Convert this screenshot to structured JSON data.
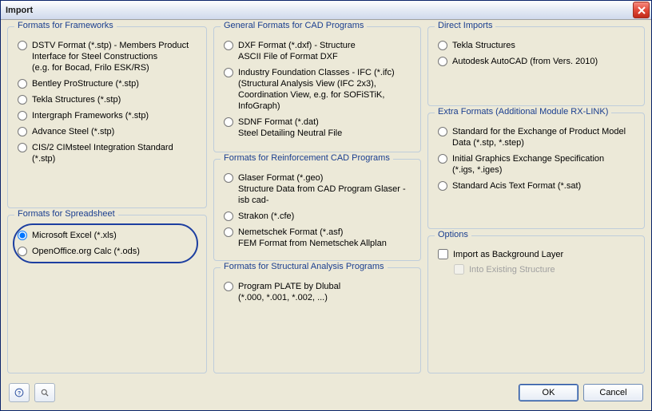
{
  "window": {
    "title": "Import"
  },
  "groups": {
    "frameworks": {
      "legend": "Formats for Frameworks",
      "items": [
        {
          "main": "DSTV Format (*.stp) - Members Product",
          "sub1": "Interface for Steel Constructions",
          "sub2": "(e.g. for Bocad, Frilo ESK/RS)"
        },
        {
          "main": "Bentley ProStructure (*.stp)"
        },
        {
          "main": "Tekla Structures (*.stp)"
        },
        {
          "main": "Intergraph Frameworks (*.stp)"
        },
        {
          "main": "Advance Steel (*.stp)"
        },
        {
          "main": "CIS/2 CIMsteel Integration Standard (*.stp)"
        }
      ]
    },
    "spreadsheet": {
      "legend": "Formats for Spreadsheet",
      "items": [
        {
          "main": "Microsoft Excel (*.xls)",
          "selected": true
        },
        {
          "main": "OpenOffice.org Calc (*.ods)"
        }
      ]
    },
    "general_cad": {
      "legend": "General Formats for CAD Programs",
      "items": [
        {
          "main": "DXF Format (*.dxf) - Structure",
          "sub1": "ASCII File of Format DXF"
        },
        {
          "main": "Industry Foundation Classes - IFC (*.ifc)",
          "sub1": "(Structural Analysis View (IFC 2x3),",
          "sub2": "Coordination View, e.g. for SOFiSTiK, InfoGraph)"
        },
        {
          "main": "SDNF Format (*.dat)",
          "sub1": "Steel Detailing Neutral File"
        }
      ]
    },
    "reinf_cad": {
      "legend": "Formats for Reinforcement CAD Programs",
      "items": [
        {
          "main": "Glaser Format (*.geo)",
          "sub1": "Structure Data from CAD Program Glaser -isb cad-"
        },
        {
          "main": "Strakon (*.cfe)"
        },
        {
          "main": "Nemetschek Format (*.asf)",
          "sub1": "FEM Format from Nemetschek Allplan"
        }
      ]
    },
    "structural": {
      "legend": "Formats for Structural Analysis Programs",
      "items": [
        {
          "main": "Program PLATE by Dlubal",
          "sub1": "(*.000, *.001, *.002, ...)"
        }
      ]
    },
    "direct_imports": {
      "legend": "Direct Imports",
      "items": [
        {
          "main": "Tekla Structures"
        },
        {
          "main": "Autodesk AutoCAD (from Vers. 2010)"
        }
      ]
    },
    "extra": {
      "legend": "Extra Formats (Additional Module RX-LINK)",
      "items": [
        {
          "main": "Standard for the Exchange of Product Model",
          "sub1": "Data (*.stp, *.step)"
        },
        {
          "main": "Initial Graphics Exchange Specification",
          "sub1": "(*.igs, *.iges)"
        },
        {
          "main": "Standard Acis Text Format (*.sat)"
        }
      ]
    },
    "options": {
      "legend": "Options",
      "bg_layer": "Import as Background Layer",
      "into_existing": "Into Existing Structure"
    }
  },
  "footer": {
    "ok": "OK",
    "cancel": "Cancel"
  }
}
